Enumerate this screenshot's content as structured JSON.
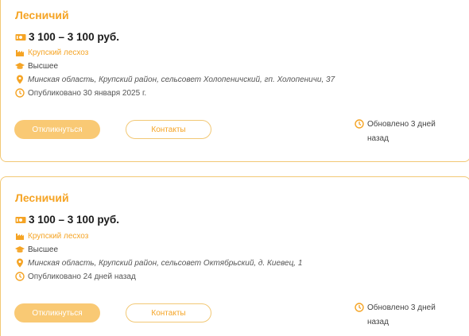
{
  "vacancies": [
    {
      "title": "Лесничий",
      "salary": "3 100 – 3 100 руб.",
      "company": "Крупский лесхоз",
      "education": "Высшее",
      "address": "Минская область, Крупский район, сельсовет Холопеничский, гп. Холопеничи, 37",
      "published": "Опубликовано 30 января 2025 г.",
      "apply_label": "Откликнуться",
      "contacts_label": "Контакты",
      "updated_line1": "Обновлено 3 дней",
      "updated_line2": "назад"
    },
    {
      "title": "Лесничий",
      "salary": "3 100 – 3 100 руб.",
      "company": "Крупский лесхоз",
      "education": "Высшее",
      "address": "Минская область, Крупский район, сельсовет Октябрьский, д. Киевец, 1",
      "published": "Опубликовано 24 дней назад",
      "apply_label": "Откликнуться",
      "contacts_label": "Контакты",
      "updated_line1": "Обновлено 3 дней",
      "updated_line2": "назад"
    }
  ],
  "icons": {
    "salary": "money-icon",
    "company": "factory-icon",
    "education": "graduation-cap-icon",
    "address": "location-pin-icon",
    "published": "clock-icon",
    "updated": "clock-icon"
  },
  "colors": {
    "accent": "#f5a425",
    "button_fill": "#f9c974",
    "border": "#f2c875"
  }
}
